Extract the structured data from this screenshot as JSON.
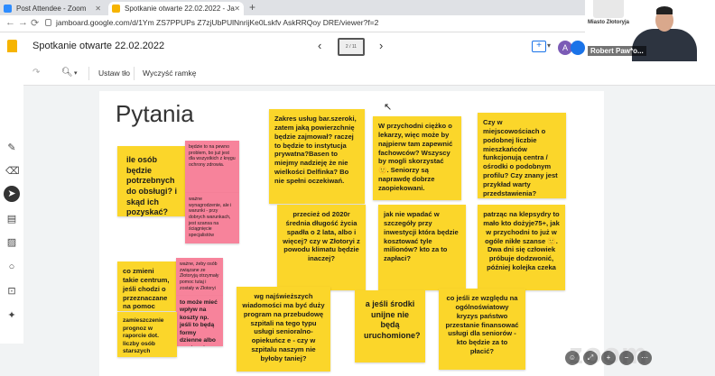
{
  "browser": {
    "tabs": [
      {
        "label": "Post Attendee - Zoom"
      },
      {
        "label": "Spotkanie otwarte 22.02.2022 - Ja"
      }
    ],
    "new_tab": "+",
    "url": "jamboard.google.com/d/1Ym ZS7PPUPs Z7zjUbPUlNnrijKe0Lskfv AskRRQoy DRE/viewer?f=2"
  },
  "jamboard": {
    "doc_title": "Spotkanie otwarte 22.02.2022",
    "frame_counter": "2 / 11",
    "toolbar": {
      "set_background": "Ustaw tło",
      "clear_frame": "Wyczyść ramkę"
    },
    "avatars": [
      "A"
    ],
    "board_title": "Pytania",
    "notes": [
      {
        "id": "n1",
        "color": "yellow",
        "text": "ile osób będzie potrzebnych do obsługi? i skąd ich pozyskać?"
      },
      {
        "id": "n2",
        "color": "pink",
        "text": "będzie to na pewno problem, bo już jest dla wszystkich z kręgu ochrony zdrowia."
      },
      {
        "id": "n3",
        "color": "pink",
        "text": "ważne wynagrodzenie, ale i warunki - przy dobrych warunkach, jest szansa na ściągnięcie specjalistów"
      },
      {
        "id": "n4",
        "color": "yellow",
        "text": "Zakres usług bar.szeroki, zatem jaką powierzchnię będzie zajmował? raczej to będzie to instytucja prywatna?Basen to miejmy nadzieję że nie wielkości Delfinka? Bo nie spełni oczekiwań."
      },
      {
        "id": "n5",
        "color": "yellow",
        "text": "W przychodni ciężko o lekarzy, więc może by najpierw tam zapewnić fachowców? Wszyscy by mogli skorzystać 🙂. Seniorzy są naprawdę dobrze zaopiekowani."
      },
      {
        "id": "n6",
        "color": "yellow",
        "text": "Czy w miejscowościach o podobnej liczbie mieszkańców funkcjonują centra / ośrodki o podobnym profilu? Czy znany jest przykład warty przedstawienia?"
      },
      {
        "id": "n7",
        "color": "yellow",
        "text": "co zmieni takie centrum, jeśli chodzi o przeznaczane na pomoc środki?"
      },
      {
        "id": "n8",
        "color": "pink",
        "text": "ważne, żeby osób związane ze Złotoryją otrzymały pomoc tutaj i zostały w Złotoryi"
      },
      {
        "id": "n9",
        "color": "pink",
        "text": "to może mieć wpływ na koszty np. jeśli to będą formy dzienne albo weekendowe"
      },
      {
        "id": "n10",
        "color": "yellow",
        "text": "zamieszczenie prognoz w raporcie dot. liczby osób starszych"
      },
      {
        "id": "n11",
        "color": "yellow",
        "text": "przecież od 2020r średnia długość życia spadła o 2 lata, albo i więcej? czy w Złotoryi z powodu klimatu będzie inaczej?"
      },
      {
        "id": "n12",
        "color": "yellow",
        "text": "jak nie wpadać w szczegóły przy inwestycji która będzie kosztować tyle milionów? kto za to zapłaci?"
      },
      {
        "id": "n13",
        "color": "yellow",
        "text": "patrząc na klepsydry to mało kto dożyje75+, jak w przychodni to już w ogóle nikłe szanse 🙂. Dwa dni się człowiek próbuje dodzwonić, później kolejka czeka"
      },
      {
        "id": "n14",
        "color": "yellow",
        "text": "wg najświeższych wiadomości ma być duży program na przebudowę szpitali na tego typu usługi senioralno-opiekuńcz e - czy w szpitalu naszym nie byłoby taniej?"
      },
      {
        "id": "n15",
        "color": "yellow",
        "text": "a jeśli środki unijne nie będą uruchomione?"
      },
      {
        "id": "n16",
        "color": "yellow",
        "text": "co jeśli ze względu na ogólnoświatowy kryzys państwo przestanie finansować usługi dla seniorów - kto będzie za to płacić?"
      }
    ]
  },
  "zoom": {
    "watermark": "zoom",
    "participant_name": "Robert Paw*o...",
    "crest_label": "Miasto Złotoryja"
  },
  "icons": {
    "undo": "undo-icon",
    "redo": "redo-icon",
    "zoom": "zoom-icon",
    "pen": "pen-icon",
    "eraser": "eraser-icon",
    "select": "cursor-icon",
    "note": "sticky-note-icon",
    "image": "image-icon",
    "circle": "shape-icon",
    "textbox": "textbox-icon",
    "laser": "laser-icon"
  }
}
